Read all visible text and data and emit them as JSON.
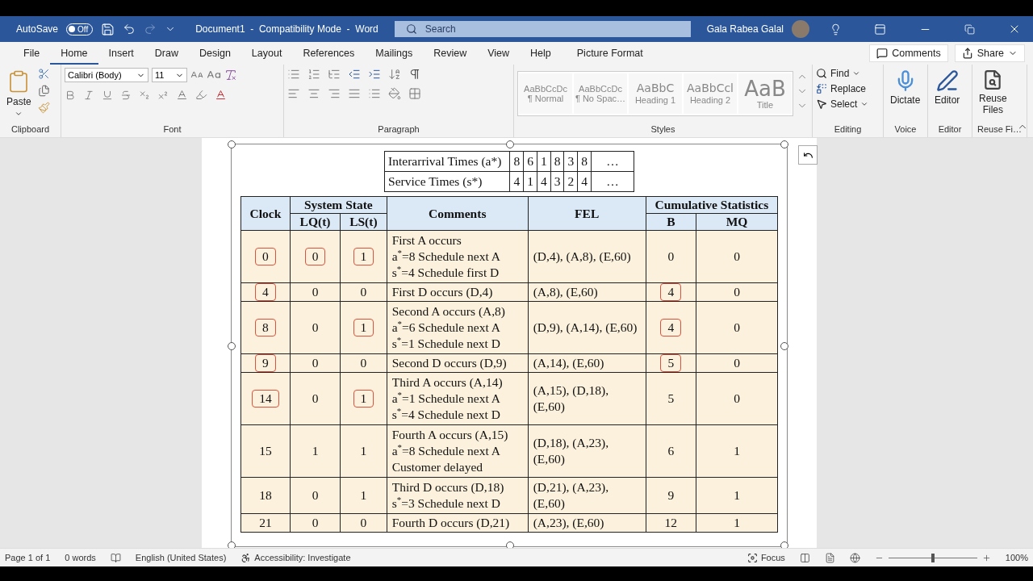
{
  "title_bar": {
    "autosave_label": "AutoSave",
    "autosave_toggle": {
      "label": "Off",
      "on": false
    },
    "document_title": "Document1  -  Compatibility Mode  -  Word",
    "search": {
      "placeholder": "Search"
    },
    "user_name": "Gala Rabea Galal"
  },
  "ribbon_tabs": [
    {
      "label": "File",
      "selected": false
    },
    {
      "label": "Home",
      "selected": true
    },
    {
      "label": "Insert",
      "selected": false
    },
    {
      "label": "Draw",
      "selected": false
    },
    {
      "label": "Design",
      "selected": false
    },
    {
      "label": "Layout",
      "selected": false
    },
    {
      "label": "References",
      "selected": false
    },
    {
      "label": "Mailings",
      "selected": false
    },
    {
      "label": "Review",
      "selected": false
    },
    {
      "label": "View",
      "selected": false
    },
    {
      "label": "Help",
      "selected": false
    },
    {
      "label": "Picture Format",
      "selected": false
    }
  ],
  "comments_button": "Comments",
  "share_button": "Share",
  "clipboard": {
    "paste": "Paste",
    "group": "Clipboard"
  },
  "font": {
    "name": "Calibri (Body)",
    "size": "11",
    "group": "Font"
  },
  "paragraph": {
    "group": "Paragraph"
  },
  "styles": {
    "group": "Styles",
    "items": [
      {
        "sample": "AaBbCcDc",
        "label": "¶ Normal",
        "kind": "normal"
      },
      {
        "sample": "AaBbCcDc",
        "label": "¶ No Spac…",
        "kind": "normal"
      },
      {
        "sample": "AaBbC",
        "label": "Heading 1",
        "kind": "heading"
      },
      {
        "sample": "AaBbCcl",
        "label": "Heading 2",
        "kind": "heading"
      },
      {
        "sample": "AaB",
        "label": "Title",
        "kind": "title"
      }
    ]
  },
  "editing": {
    "group": "Editing",
    "find": "Find",
    "replace": "Replace",
    "select": "Select"
  },
  "voice": {
    "group": "Voice",
    "button": "Dictate"
  },
  "editor": {
    "group": "Editor",
    "button": "Editor"
  },
  "reuse": {
    "group": "Reuse Fi…",
    "button": "Reuse\nFiles"
  },
  "input_table": {
    "rows": [
      {
        "label": "Interarrival Times (a*)",
        "values": [
          "8",
          "6",
          "1",
          "8",
          "3",
          "8",
          "…"
        ]
      },
      {
        "label": "Service Times (s*)",
        "values": [
          "4",
          "1",
          "4",
          "3",
          "2",
          "4",
          "…"
        ]
      }
    ]
  },
  "sim_table": {
    "headers": {
      "clock": "Clock",
      "system_state": "System State",
      "lq": "LQ(t)",
      "ls": "LS(t)",
      "comments": "Comments",
      "fel": "FEL",
      "cumulative": "Cumulative Statistics",
      "b": "B",
      "mq": "MQ"
    },
    "rows": [
      {
        "cells": [
          {
            "text": "0",
            "boxed": true
          },
          {
            "text": "0",
            "boxed": true
          },
          {
            "text": "1",
            "boxed": true
          },
          {
            "text": "First A occurs\na$^{*}$=8 Schedule next A\ns$^{*}$=4 Schedule first D",
            "boxed": false
          },
          {
            "text": "(D,4), (A,8), (E,60)",
            "boxed": false
          },
          {
            "text": "0",
            "boxed": false
          },
          {
            "text": "0",
            "boxed": false
          }
        ]
      },
      {
        "cells": [
          {
            "text": "4",
            "boxed": true
          },
          {
            "text": "0",
            "boxed": false
          },
          {
            "text": "0",
            "boxed": false
          },
          {
            "text": "First D occurs (D,4)",
            "boxed": false
          },
          {
            "text": "(A,8), (E,60)",
            "boxed": false
          },
          {
            "text": "4",
            "boxed": true
          },
          {
            "text": "0",
            "boxed": false
          }
        ]
      },
      {
        "cells": [
          {
            "text": "8",
            "boxed": true
          },
          {
            "text": "0",
            "boxed": false
          },
          {
            "text": "1",
            "boxed": true
          },
          {
            "text": "Second A occurs (A,8)\na$^{*}$=6 Schedule next A\ns$^{*}$=1 Schedule next D",
            "boxed": false
          },
          {
            "text": "(D,9), (A,14), (E,60)",
            "boxed": false
          },
          {
            "text": "4",
            "boxed": true
          },
          {
            "text": "0",
            "boxed": false
          }
        ]
      },
      {
        "cells": [
          {
            "text": "9",
            "boxed": true
          },
          {
            "text": "0",
            "boxed": false
          },
          {
            "text": "0",
            "boxed": false
          },
          {
            "text": "Second D occurs (D,9)",
            "boxed": false
          },
          {
            "text": "(A,14), (E,60)",
            "boxed": false
          },
          {
            "text": "5",
            "boxed": true
          },
          {
            "text": "0",
            "boxed": false
          }
        ]
      },
      {
        "cells": [
          {
            "text": "14",
            "boxed": true
          },
          {
            "text": "0",
            "boxed": false
          },
          {
            "text": "1",
            "boxed": true
          },
          {
            "text": "Third A occurs (A,14)\na$^{*}$=1 Schedule next A\ns$^{*}$=4 Schedule next D",
            "boxed": false
          },
          {
            "text": "(A,15), (D,18),\n(E,60)",
            "boxed": false
          },
          {
            "text": "5",
            "boxed": false
          },
          {
            "text": "0",
            "boxed": false
          }
        ]
      },
      {
        "cells": [
          {
            "text": "15",
            "boxed": false
          },
          {
            "text": "1",
            "boxed": false
          },
          {
            "text": "1",
            "boxed": false
          },
          {
            "text": "Fourth A occurs (A,15)\na$^{*}$=8 Schedule next A\nCustomer delayed",
            "boxed": false
          },
          {
            "text": "(D,18), (A,23),\n(E,60)",
            "boxed": false
          },
          {
            "text": "6",
            "boxed": false
          },
          {
            "text": "1",
            "boxed": false
          }
        ]
      },
      {
        "cells": [
          {
            "text": "18",
            "boxed": false
          },
          {
            "text": "0",
            "boxed": false
          },
          {
            "text": "1",
            "boxed": false
          },
          {
            "text": "Third D occurs (D,18)\ns$^{*}$=3 Schedule next D",
            "boxed": false
          },
          {
            "text": "(D,21), (A,23),\n(E,60)",
            "boxed": false
          },
          {
            "text": "9",
            "boxed": false
          },
          {
            "text": "1",
            "boxed": false
          }
        ]
      },
      {
        "cells": [
          {
            "text": "21",
            "boxed": false
          },
          {
            "text": "0",
            "boxed": false
          },
          {
            "text": "0",
            "boxed": false
          },
          {
            "text": "Fourth D occurs (D,21)",
            "boxed": false
          },
          {
            "text": "(A,23), (E,60)",
            "boxed": false
          },
          {
            "text": "12",
            "boxed": false
          },
          {
            "text": "1",
            "boxed": false
          }
        ]
      }
    ]
  },
  "status_bar": {
    "zoom_slider": {
      "level": 0.5
    },
    "page": "Page 1 of 1",
    "words": "0 words",
    "language": "English (United States)",
    "accessibility": "Accessibility: Investigate",
    "focus": "Focus",
    "zoom": "100%"
  }
}
